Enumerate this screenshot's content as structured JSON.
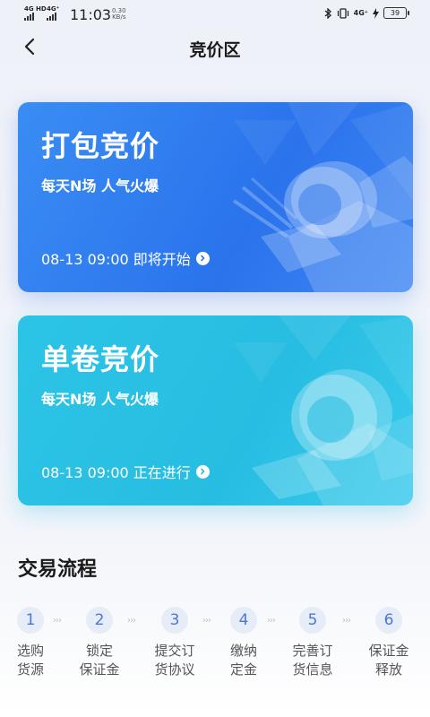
{
  "status_bar": {
    "net1": "4G HD",
    "net2": "4G⁺",
    "time": "11:03",
    "speed_value": "0.30",
    "speed_unit": "KB/s",
    "net3": "4G⁺",
    "battery": "39"
  },
  "header": {
    "title": "竞价区"
  },
  "cards": [
    {
      "title": "打包竞价",
      "subtitle": "每天N场 人气火爆",
      "meta": "08-13 09:00 即将开始",
      "color": "#2f7cf0"
    },
    {
      "title": "单卷竞价",
      "subtitle": "每天N场 人气火爆",
      "meta": "08-13 09:00 正在进行",
      "color": "#2cc2e5"
    }
  ],
  "process": {
    "title": "交易流程",
    "steps": [
      {
        "num": "1",
        "line1": "选购",
        "line2": "货源"
      },
      {
        "num": "2",
        "line1": "锁定",
        "line2": "保证金"
      },
      {
        "num": "3",
        "line1": "提交订",
        "line2": "货协议"
      },
      {
        "num": "4",
        "line1": "缴纳",
        "line2": "定金"
      },
      {
        "num": "5",
        "line1": "完善订",
        "line2": "货信息"
      },
      {
        "num": "6",
        "line1": "保证金",
        "line2": "释放"
      }
    ],
    "separator": "›››"
  }
}
